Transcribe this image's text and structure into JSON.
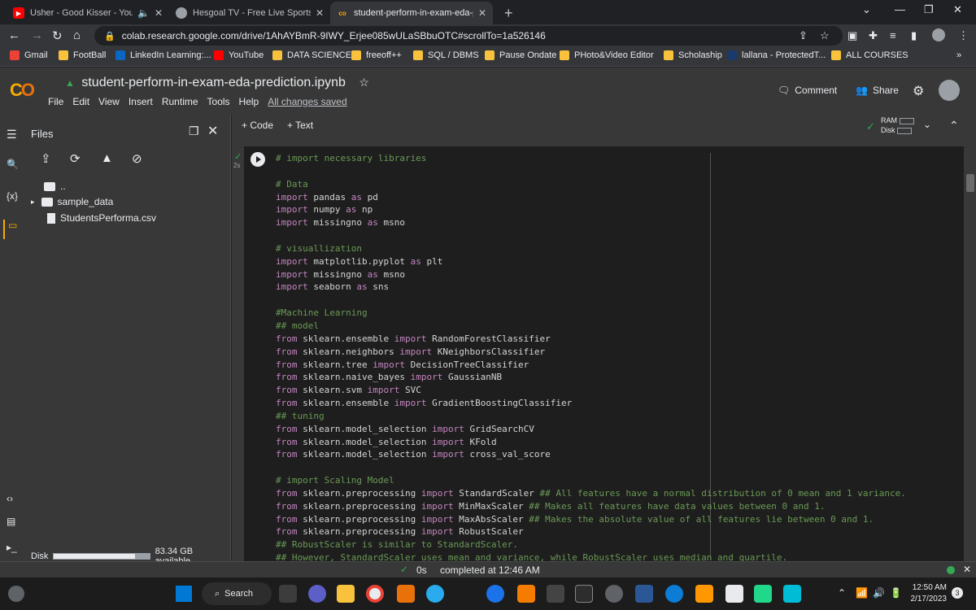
{
  "browser": {
    "tabs": [
      {
        "title": "Usher - Good Kisser - YouTube",
        "icon": "youtube-icon",
        "color": "#ff0000"
      },
      {
        "title": "Hesgoal TV - Free Live Sports Streaming",
        "icon": "globe-icon",
        "color": "#9aa0a6"
      },
      {
        "title": "student-perform-in-exam-eda-prediction.ipynb",
        "icon": "colab-icon",
        "color": "#f9ab00"
      }
    ],
    "url": "colab.research.google.com/drive/1AhAYBmR-9IWY_Erjee085wULaSBbuOTC#scrollTo=1a526146",
    "bookmarks": [
      "Gmail",
      "FootBall",
      "LinkedIn Learning:...",
      "YouTube",
      "DATA SCIENCE",
      "freeoff++",
      "SQL / DBMS",
      "Pause Ondate",
      "PHoto&Video Editor",
      "Scholaship",
      "lallana - ProtectedT...",
      "ALL COURSES"
    ],
    "bookmark_overflow": "»"
  },
  "colab": {
    "logo": "CO",
    "title": "student-perform-in-exam-eda-prediction.ipynb",
    "menu": [
      "File",
      "Edit",
      "View",
      "Insert",
      "Runtime",
      "Tools",
      "Help"
    ],
    "saved_status": "All changes saved",
    "comment": "Comment",
    "share": "Share",
    "add_code": "+ Code",
    "add_text": "+ Text",
    "ram_label": "RAM",
    "disk_label": "Disk"
  },
  "files_panel": {
    "title": "Files",
    "items": [
      {
        "name": "..",
        "type": "folder-up"
      },
      {
        "name": "sample_data",
        "type": "folder"
      },
      {
        "name": "StudentsPerforma.csv",
        "type": "file"
      }
    ],
    "disk_label": "Disk",
    "disk_available": "83.34 GB available",
    "disk_fraction_used": 0.85
  },
  "cell": {
    "exec_time": "2s",
    "code_lines": [
      [
        [
          "c",
          "# import necessary libraries"
        ]
      ],
      [],
      [
        [
          "c",
          "# Data"
        ]
      ],
      [
        [
          "k",
          "import"
        ],
        [
          "t",
          " pandas "
        ],
        [
          "k",
          "as"
        ],
        [
          "t",
          " pd"
        ]
      ],
      [
        [
          "k",
          "import"
        ],
        [
          "t",
          " numpy "
        ],
        [
          "k",
          "as"
        ],
        [
          "t",
          " np"
        ]
      ],
      [
        [
          "k",
          "import"
        ],
        [
          "t",
          " missingno "
        ],
        [
          "k",
          "as"
        ],
        [
          "t",
          " msno"
        ]
      ],
      [],
      [
        [
          "c",
          "# visuallization"
        ]
      ],
      [
        [
          "k",
          "import"
        ],
        [
          "t",
          " matplotlib.pyplot "
        ],
        [
          "k",
          "as"
        ],
        [
          "t",
          " plt"
        ]
      ],
      [
        [
          "k",
          "import"
        ],
        [
          "t",
          " missingno "
        ],
        [
          "k",
          "as"
        ],
        [
          "t",
          " msno"
        ]
      ],
      [
        [
          "k",
          "import"
        ],
        [
          "t",
          " seaborn "
        ],
        [
          "k",
          "as"
        ],
        [
          "t",
          " sns"
        ]
      ],
      [],
      [
        [
          "c",
          "#Machine Learning"
        ]
      ],
      [
        [
          "c",
          "## model"
        ]
      ],
      [
        [
          "k",
          "from"
        ],
        [
          "t",
          " sklearn.ensemble "
        ],
        [
          "k",
          "import"
        ],
        [
          "t",
          " RandomForestClassifier"
        ]
      ],
      [
        [
          "k",
          "from"
        ],
        [
          "t",
          " sklearn.neighbors "
        ],
        [
          "k",
          "import"
        ],
        [
          "t",
          " KNeighborsClassifier"
        ]
      ],
      [
        [
          "k",
          "from"
        ],
        [
          "t",
          " sklearn.tree "
        ],
        [
          "k",
          "import"
        ],
        [
          "t",
          " DecisionTreeClassifier"
        ]
      ],
      [
        [
          "k",
          "from"
        ],
        [
          "t",
          " sklearn.naive_bayes "
        ],
        [
          "k",
          "import"
        ],
        [
          "t",
          " GaussianNB"
        ]
      ],
      [
        [
          "k",
          "from"
        ],
        [
          "t",
          " sklearn.svm "
        ],
        [
          "k",
          "import"
        ],
        [
          "t",
          " SVC"
        ]
      ],
      [
        [
          "k",
          "from"
        ],
        [
          "t",
          " sklearn.ensemble "
        ],
        [
          "k",
          "import"
        ],
        [
          "t",
          " GradientBoostingClassifier"
        ]
      ],
      [
        [
          "c",
          "## tuning"
        ]
      ],
      [
        [
          "k",
          "from"
        ],
        [
          "t",
          " sklearn.model_selection "
        ],
        [
          "k",
          "import"
        ],
        [
          "t",
          " GridSearchCV"
        ]
      ],
      [
        [
          "k",
          "from"
        ],
        [
          "t",
          " sklearn.model_selection "
        ],
        [
          "k",
          "import"
        ],
        [
          "t",
          " KFold"
        ]
      ],
      [
        [
          "k",
          "from"
        ],
        [
          "t",
          " sklearn.model_selection "
        ],
        [
          "k",
          "import"
        ],
        [
          "t",
          " cross_val_score"
        ]
      ],
      [],
      [
        [
          "c",
          "# import Scaling Model"
        ]
      ],
      [
        [
          "k",
          "from"
        ],
        [
          "t",
          " sklearn.preprocessing "
        ],
        [
          "k",
          "import"
        ],
        [
          "t",
          " StandardScaler "
        ],
        [
          "c",
          "## All features have a normal distribution of 0 mean and 1 variance."
        ]
      ],
      [
        [
          "k",
          "from"
        ],
        [
          "t",
          " sklearn.preprocessing "
        ],
        [
          "k",
          "import"
        ],
        [
          "t",
          " MinMaxScaler "
        ],
        [
          "c",
          "## Makes all features have data values between 0 and 1."
        ]
      ],
      [
        [
          "k",
          "from"
        ],
        [
          "t",
          " sklearn.preprocessing "
        ],
        [
          "k",
          "import"
        ],
        [
          "t",
          " MaxAbsScaler "
        ],
        [
          "c",
          "## Makes the absolute value of all features lie between 0 and 1."
        ]
      ],
      [
        [
          "k",
          "from"
        ],
        [
          "t",
          " sklearn.preprocessing "
        ],
        [
          "k",
          "import"
        ],
        [
          "t",
          " RobustScaler"
        ]
      ],
      [
        [
          "c",
          "## RobustScaler is similar to StandardScaler."
        ]
      ],
      [
        [
          "c",
          "## However, StandardScaler uses mean and variance, while RobustScaler uses median and quartile."
        ]
      ]
    ]
  },
  "status": {
    "elapsed": "0s",
    "message": "completed at 12:46 AM"
  },
  "taskbar": {
    "search": "Search",
    "time": "12:50 AM",
    "date": "2/17/2023",
    "notifications": "3"
  }
}
